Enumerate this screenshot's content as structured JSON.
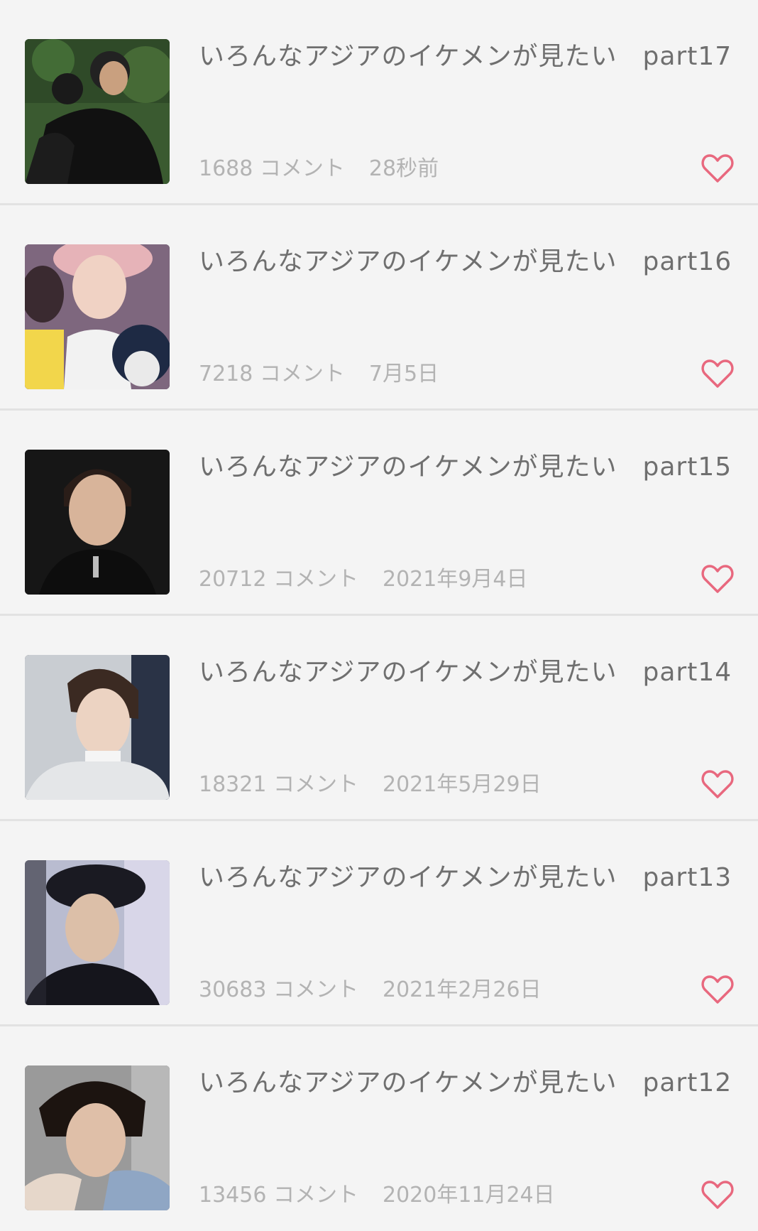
{
  "threads": [
    {
      "title": "いろんなアジアのイケメンが見たい",
      "part": "part17",
      "comments": "1688 コメント",
      "date": "28秒前"
    },
    {
      "title": "いろんなアジアのイケメンが見たい",
      "part": "part16",
      "comments": "7218 コメント",
      "date": "7月5日"
    },
    {
      "title": "いろんなアジアのイケメンが見たい",
      "part": "part15",
      "comments": "20712 コメント",
      "date": "2021年9月4日"
    },
    {
      "title": "いろんなアジアのイケメンが見たい",
      "part": "part14",
      "comments": "18321 コメント",
      "date": "2021年5月29日"
    },
    {
      "title": "いろんなアジアのイケメンが見たい",
      "part": "part13",
      "comments": "30683 コメント",
      "date": "2021年2月26日"
    },
    {
      "title": "いろんなアジアのイケメンが見たい",
      "part": "part12",
      "comments": "13456 コメント",
      "date": "2020年11月24日"
    }
  ],
  "icons": {
    "favorite": "heart-outline-icon"
  },
  "colors": {
    "heart": "#e8687e",
    "title": "#6f6f6f",
    "meta": "#b3b3b3"
  }
}
